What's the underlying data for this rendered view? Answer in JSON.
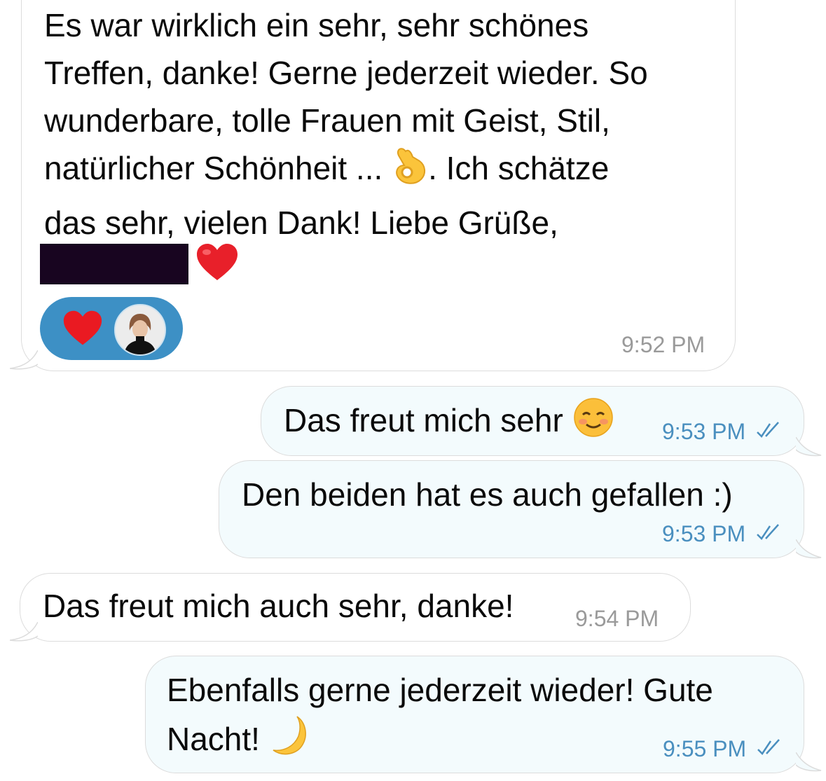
{
  "messages": [
    {
      "direction": "incoming",
      "lines": [
        "Es war wirklich ein sehr, sehr schönes",
        "Treffen, danke! Gerne jederzeit wieder. So",
        "wunderbare, tolle Frauen mit Geist, Stil,",
        "natürlicher Schönheit ... ",
        ". Ich schätze",
        "das sehr, vielen Dank! Liebe Grüße,"
      ],
      "emoji": "ok-hand-icon",
      "signature_emoji": "red-heart-icon",
      "reaction": {
        "emoji": "red-heart-icon",
        "avatar": "user-avatar"
      },
      "time": "9:52 PM"
    },
    {
      "direction": "outgoing",
      "text": "Das freut mich sehr",
      "emoji": "smiling-face-icon",
      "time": "9:53 PM",
      "status": "read-double-check-icon"
    },
    {
      "direction": "outgoing",
      "text": "Den beiden hat es auch gefallen :)",
      "time": "9:53 PM",
      "status": "read-double-check-icon"
    },
    {
      "direction": "incoming",
      "text": "Das freut mich auch sehr, danke!",
      "time": "9:54 PM"
    },
    {
      "direction": "outgoing",
      "lines": [
        "Ebenfalls gerne jederzeit wieder! Gute",
        "Nacht! "
      ],
      "emoji": "crescent-moon-icon",
      "time": "9:55 PM",
      "status": "read-double-check-icon"
    }
  ],
  "colors": {
    "incoming_bubble": "#ffffff",
    "outgoing_bubble": "#f3fbfd",
    "bubble_border": "#dcdcdc",
    "time_incoming": "#9a9a9a",
    "time_outgoing": "#4a8fbf",
    "reaction_pill": "#3d90c5",
    "redaction": "#180520"
  }
}
